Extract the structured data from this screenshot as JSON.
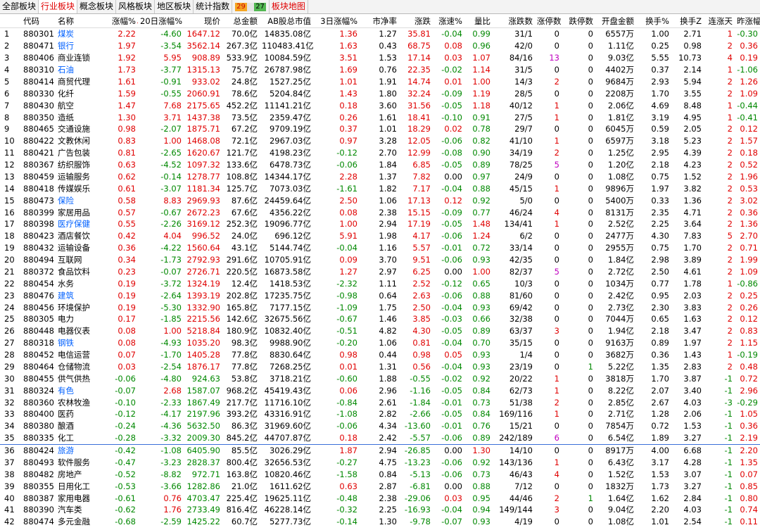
{
  "tabs": [
    {
      "label": "全部板块",
      "active": false
    },
    {
      "label": "行业板块",
      "active": true
    },
    {
      "label": "概念板块",
      "active": false
    },
    {
      "label": "风格板块",
      "active": false
    },
    {
      "label": "地区板块",
      "active": false
    },
    {
      "label": "统计指数",
      "active": false
    }
  ],
  "breadth": {
    "up": "29",
    "flat": "",
    "down": "27"
  },
  "map_tab": "板块地图",
  "columns": [
    "",
    "代码",
    "名称",
    "涨幅%",
    "20日涨幅%",
    "现价",
    "总金额",
    "AB股总市值",
    "3日涨幅%",
    "市净率",
    "涨跌",
    "涨速%",
    "量比",
    "涨跌数",
    "涨停数",
    "跌停数",
    "开盘金额",
    "换手%",
    "换手Z",
    "连涨天",
    "昨涨幅%"
  ],
  "sort_indicator": "↓",
  "rows": [
    [
      "1",
      "880301",
      "煤炭",
      "2.22",
      "-4.60",
      "1647.12",
      "70.0亿",
      "14835.08亿",
      "1.36",
      "1.27",
      "35.81",
      "-0.04",
      "0.99",
      "31/1",
      "0",
      "0",
      "6557万",
      "1.00",
      "2.71",
      "1",
      "-0.30"
    ],
    [
      "2",
      "880471",
      "银行",
      "1.97",
      "-3.54",
      "3562.14",
      "267.3亿",
      "110483.41亿",
      "1.63",
      "0.43",
      "68.75",
      "0.08",
      "0.96",
      "42/0",
      "0",
      "0",
      "1.11亿",
      "0.25",
      "0.98",
      "2",
      "0.36"
    ],
    [
      "3",
      "880406",
      "商业连锁",
      "1.92",
      "5.95",
      "908.89",
      "533.9亿",
      "10084.59亿",
      "3.51",
      "1.53",
      "17.14",
      "0.03",
      "1.07",
      "84/16",
      "13",
      "0",
      "9.03亿",
      "5.55",
      "10.73",
      "4",
      "0.19"
    ],
    [
      "4",
      "880310",
      "石油",
      "1.73",
      "-3.77",
      "1315.13",
      "75.7亿",
      "26787.98亿",
      "1.69",
      "0.76",
      "22.35",
      "-0.02",
      "1.14",
      "31/5",
      "0",
      "0",
      "4402万",
      "0.37",
      "2.14",
      "1",
      "-1.06"
    ],
    [
      "5",
      "880414",
      "商贸代理",
      "1.61",
      "-0.91",
      "933.02",
      "24.8亿",
      "1527.25亿",
      "1.01",
      "1.91",
      "14.74",
      "0.01",
      "1.00",
      "14/3",
      "2",
      "0",
      "9684万",
      "2.93",
      "5.94",
      "2",
      "1.26"
    ],
    [
      "6",
      "880330",
      "化纤",
      "1.59",
      "-0.55",
      "2060.91",
      "78.6亿",
      "5204.84亿",
      "1.43",
      "1.80",
      "32.24",
      "-0.09",
      "1.19",
      "28/5",
      "0",
      "0",
      "2208万",
      "1.70",
      "3.55",
      "2",
      "1.09"
    ],
    [
      "7",
      "880430",
      "航空",
      "1.47",
      "7.68",
      "2175.65",
      "452.2亿",
      "11141.21亿",
      "0.18",
      "3.60",
      "31.56",
      "-0.05",
      "1.18",
      "40/12",
      "1",
      "0",
      "2.06亿",
      "4.69",
      "8.48",
      "1",
      "-0.44"
    ],
    [
      "8",
      "880350",
      "造纸",
      "1.30",
      "3.71",
      "1437.38",
      "73.5亿",
      "2359.47亿",
      "0.26",
      "1.61",
      "18.41",
      "-0.10",
      "0.91",
      "27/5",
      "1",
      "0",
      "1.81亿",
      "3.19",
      "4.95",
      "1",
      "-0.41"
    ],
    [
      "9",
      "880465",
      "交通设施",
      "0.98",
      "-2.07",
      "1875.71",
      "67.2亿",
      "9709.19亿",
      "0.37",
      "1.01",
      "18.29",
      "0.02",
      "0.78",
      "29/7",
      "0",
      "0",
      "6045万",
      "0.59",
      "2.05",
      "2",
      "0.12"
    ],
    [
      "10",
      "880422",
      "文教休闲",
      "0.83",
      "1.00",
      "1468.08",
      "72.1亿",
      "2967.03亿",
      "0.97",
      "3.28",
      "12.05",
      "-0.06",
      "0.82",
      "41/10",
      "1",
      "0",
      "6597万",
      "3.18",
      "5.23",
      "2",
      "1.57"
    ],
    [
      "11",
      "880421",
      "广告包装",
      "0.81",
      "-2.65",
      "1620.67",
      "121.7亿",
      "4198.23亿",
      "-0.12",
      "2.70",
      "12.99",
      "-0.08",
      "0.90",
      "34/19",
      "2",
      "0",
      "1.25亿",
      "2.95",
      "4.39",
      "2",
      "0.18"
    ],
    [
      "12",
      "880367",
      "纺织服饰",
      "0.63",
      "-4.52",
      "1097.32",
      "133.6亿",
      "6478.73亿",
      "-0.06",
      "1.84",
      "6.85",
      "-0.05",
      "0.89",
      "78/25",
      "5",
      "0",
      "1.20亿",
      "2.18",
      "4.23",
      "2",
      "0.52"
    ],
    [
      "13",
      "880459",
      "运输服务",
      "0.62",
      "-0.14",
      "1278.77",
      "108.8亿",
      "14344.17亿",
      "2.28",
      "1.37",
      "7.82",
      "0.00",
      "0.97",
      "24/9",
      "0",
      "0",
      "1.08亿",
      "0.75",
      "1.52",
      "2",
      "1.96"
    ],
    [
      "14",
      "880418",
      "传媒娱乐",
      "0.61",
      "-3.07",
      "1181.34",
      "125.7亿",
      "7073.03亿",
      "-1.61",
      "1.82",
      "7.17",
      "-0.04",
      "0.88",
      "45/15",
      "1",
      "0",
      "9896万",
      "1.97",
      "3.82",
      "2",
      "0.53"
    ],
    [
      "15",
      "880473",
      "保险",
      "0.58",
      "8.83",
      "2969.93",
      "87.6亿",
      "24459.64亿",
      "2.50",
      "1.06",
      "17.13",
      "0.12",
      "0.92",
      "5/0",
      "0",
      "0",
      "5400万",
      "0.33",
      "1.36",
      "2",
      "3.02"
    ],
    [
      "16",
      "880399",
      "家居用品",
      "0.57",
      "-0.67",
      "2672.23",
      "67.6亿",
      "4356.22亿",
      "0.08",
      "2.38",
      "15.15",
      "-0.09",
      "0.77",
      "46/24",
      "4",
      "0",
      "8131万",
      "2.35",
      "4.71",
      "2",
      "0.36"
    ],
    [
      "17",
      "880398",
      "医疗保健",
      "0.55",
      "-2.26",
      "3169.12",
      "252.3亿",
      "19096.77亿",
      "1.00",
      "2.94",
      "17.19",
      "-0.05",
      "1.48",
      "134/41",
      "1",
      "0",
      "2.52亿",
      "2.25",
      "3.64",
      "2",
      "1.36"
    ],
    [
      "18",
      "880423",
      "酒店餐饮",
      "0.42",
      "4.04",
      "996.52",
      "24.0亿",
      "696.12亿",
      "5.91",
      "1.98",
      "4.17",
      "-0.06",
      "1.24",
      "6/2",
      "0",
      "0",
      "2477万",
      "4.30",
      "7.83",
      "5",
      "2.70"
    ],
    [
      "19",
      "880432",
      "运输设备",
      "0.36",
      "-4.22",
      "1560.64",
      "43.1亿",
      "5144.74亿",
      "-0.04",
      "1.16",
      "5.57",
      "-0.01",
      "0.72",
      "33/14",
      "0",
      "0",
      "2955万",
      "0.75",
      "1.70",
      "2",
      "0.71"
    ],
    [
      "20",
      "880494",
      "互联网",
      "0.34",
      "-1.73",
      "2792.93",
      "291.6亿",
      "10705.91亿",
      "0.09",
      "3.70",
      "9.51",
      "-0.06",
      "0.93",
      "42/35",
      "0",
      "0",
      "1.84亿",
      "2.98",
      "3.89",
      "2",
      "1.99"
    ],
    [
      "21",
      "880372",
      "食品饮料",
      "0.23",
      "-0.07",
      "2726.71",
      "220.5亿",
      "16873.58亿",
      "1.27",
      "2.97",
      "6.25",
      "0.00",
      "1.00",
      "82/37",
      "5",
      "0",
      "2.72亿",
      "2.50",
      "4.61",
      "2",
      "1.09"
    ],
    [
      "22",
      "880454",
      "水务",
      "0.19",
      "-3.72",
      "1324.19",
      "12.4亿",
      "1418.53亿",
      "-2.32",
      "1.11",
      "2.52",
      "-0.12",
      "0.65",
      "10/3",
      "0",
      "0",
      "1034万",
      "0.77",
      "1.78",
      "1",
      "-0.86"
    ],
    [
      "23",
      "880476",
      "建筑",
      "0.19",
      "-2.64",
      "1393.19",
      "202.8亿",
      "17235.75亿",
      "-0.98",
      "0.64",
      "2.63",
      "-0.06",
      "0.88",
      "81/60",
      "0",
      "0",
      "2.42亿",
      "0.95",
      "2.03",
      "2",
      "0.25"
    ],
    [
      "24",
      "880456",
      "环境保护",
      "0.19",
      "-5.30",
      "1332.90",
      "165.8亿",
      "7177.15亿",
      "-1.09",
      "1.75",
      "2.50",
      "-0.04",
      "0.93",
      "69/42",
      "0",
      "0",
      "2.73亿",
      "2.30",
      "3.83",
      "2",
      "0.26"
    ],
    [
      "25",
      "880305",
      "电力",
      "0.17",
      "-1.85",
      "2215.56",
      "142.6亿",
      "32675.56亿",
      "-0.67",
      "1.46",
      "3.85",
      "-0.03",
      "0.66",
      "32/38",
      "0",
      "0",
      "7044万",
      "0.65",
      "1.63",
      "2",
      "0.12"
    ],
    [
      "26",
      "880448",
      "电器仪表",
      "0.08",
      "1.00",
      "5218.84",
      "180.9亿",
      "10832.40亿",
      "-0.51",
      "4.82",
      "4.30",
      "-0.05",
      "0.89",
      "63/37",
      "3",
      "0",
      "1.94亿",
      "2.18",
      "3.47",
      "2",
      "0.83"
    ],
    [
      "27",
      "880318",
      "钢铁",
      "0.08",
      "-4.93",
      "1035.20",
      "98.3亿",
      "9988.90亿",
      "-0.20",
      "1.06",
      "0.81",
      "-0.04",
      "0.70",
      "35/15",
      "0",
      "0",
      "9163万",
      "0.89",
      "1.97",
      "2",
      "1.15"
    ],
    [
      "28",
      "880452",
      "电信运营",
      "0.07",
      "-1.70",
      "1405.28",
      "77.8亿",
      "8830.64亿",
      "0.98",
      "0.44",
      "0.98",
      "0.05",
      "0.93",
      "1/4",
      "0",
      "0",
      "3682万",
      "0.36",
      "1.43",
      "1",
      "-0.19"
    ],
    [
      "29",
      "880464",
      "仓储物流",
      "0.03",
      "-2.54",
      "1876.17",
      "77.8亿",
      "7268.25亿",
      "0.01",
      "1.31",
      "0.56",
      "-0.04",
      "0.93",
      "23/19",
      "0",
      "1",
      "5.22亿",
      "1.35",
      "2.83",
      "2",
      "0.48"
    ],
    [
      "30",
      "880455",
      "供气供热",
      "-0.06",
      "-4.80",
      "924.63",
      "53.8亿",
      "3718.21亿",
      "-0.60",
      "1.88",
      "-0.55",
      "-0.02",
      "0.92",
      "20/22",
      "1",
      "0",
      "3818万",
      "1.70",
      "3.87",
      "-1",
      "0.72"
    ],
    [
      "31",
      "880324",
      "有色",
      "-0.07",
      "2.68",
      "1587.07",
      "968.2亿",
      "45419.43亿",
      "0.06",
      "2.96",
      "-1.16",
      "-0.05",
      "0.84",
      "62/73",
      "1",
      "0",
      "8.22亿",
      "2.07",
      "3.40",
      "-1",
      "2.96"
    ],
    [
      "32",
      "880360",
      "农林牧渔",
      "-0.10",
      "-2.33",
      "1867.49",
      "217.7亿",
      "11716.10亿",
      "-0.84",
      "2.61",
      "-1.84",
      "-0.01",
      "0.73",
      "51/38",
      "2",
      "0",
      "2.85亿",
      "2.67",
      "4.03",
      "-3",
      "-0.29"
    ],
    [
      "33",
      "880400",
      "医药",
      "-0.12",
      "-4.17",
      "2197.96",
      "393.2亿",
      "43316.91亿",
      "-1.08",
      "2.82",
      "-2.66",
      "-0.05",
      "0.84",
      "169/116",
      "1",
      "0",
      "2.71亿",
      "1.28",
      "2.06",
      "-1",
      "1.05"
    ],
    [
      "34",
      "880380",
      "酿酒",
      "-0.24",
      "-4.36",
      "5632.50",
      "86.3亿",
      "31969.60亿",
      "-0.06",
      "4.34",
      "-13.60",
      "-0.01",
      "0.76",
      "15/21",
      "0",
      "0",
      "7854万",
      "0.72",
      "1.53",
      "-1",
      "0.36"
    ],
    [
      "35",
      "880335",
      "化工",
      "-0.28",
      "-3.32",
      "2009.30",
      "845.2亿",
      "44707.87亿",
      "0.18",
      "2.42",
      "-5.57",
      "-0.06",
      "0.89",
      "242/189",
      "6",
      "0",
      "6.54亿",
      "1.89",
      "3.27",
      "-1",
      "2.19"
    ],
    [
      "36",
      "880424",
      "旅游",
      "-0.42",
      "-1.08",
      "6405.90",
      "85.5亿",
      "3026.29亿",
      "1.87",
      "2.94",
      "-26.85",
      "0.00",
      "1.30",
      "14/10",
      "0",
      "0",
      "8917万",
      "4.00",
      "6.68",
      "-1",
      "2.20"
    ],
    [
      "37",
      "880493",
      "软件服务",
      "-0.47",
      "-3.23",
      "2828.37",
      "800.4亿",
      "32656.53亿",
      "-0.27",
      "4.75",
      "-13.23",
      "-0.06",
      "0.92",
      "143/136",
      "1",
      "0",
      "6.43亿",
      "3.17",
      "4.28",
      "-1",
      "1.35"
    ],
    [
      "38",
      "880482",
      "房地产",
      "-0.52",
      "-8.82",
      "972.71",
      "163.8亿",
      "10820.46亿",
      "-1.58",
      "0.84",
      "-5.13",
      "-0.06",
      "0.73",
      "46/43",
      "4",
      "0",
      "1.52亿",
      "1.53",
      "3.07",
      "-1",
      "0.07"
    ],
    [
      "39",
      "880355",
      "日用化工",
      "-0.53",
      "-3.66",
      "1282.86",
      "21.0亿",
      "1611.62亿",
      "0.63",
      "2.87",
      "-6.81",
      "0.00",
      "0.88",
      "7/12",
      "0",
      "0",
      "1832万",
      "1.73",
      "3.27",
      "-1",
      "0.85"
    ],
    [
      "40",
      "880387",
      "家用电器",
      "-0.61",
      "0.76",
      "4703.47",
      "225.4亿",
      "19625.11亿",
      "-0.48",
      "2.38",
      "-29.06",
      "0.03",
      "0.95",
      "44/46",
      "2",
      "1",
      "1.64亿",
      "1.62",
      "2.84",
      "-1",
      "0.80"
    ],
    [
      "41",
      "880390",
      "汽车类",
      "-0.62",
      "1.76",
      "2733.49",
      "816.4亿",
      "46228.14亿",
      "-0.32",
      "2.25",
      "-16.93",
      "-0.04",
      "0.94",
      "149/144",
      "3",
      "0",
      "9.04亿",
      "2.20",
      "4.03",
      "-1",
      "0.74"
    ],
    [
      "42",
      "880474",
      "多元金融",
      "-0.68",
      "-2.59",
      "1425.22",
      "60.7亿",
      "5277.73亿",
      "-0.14",
      "1.30",
      "-9.78",
      "-0.07",
      "0.93",
      "4/19",
      "0",
      "0",
      "1.08亿",
      "1.01",
      "2.54",
      "-1",
      "0.11"
    ]
  ],
  "highlight_names": [
    "煤炭",
    "银行",
    "石油",
    "保险",
    "医疗保健",
    "建筑",
    "钢铁",
    "有色",
    "旅游"
  ],
  "colors": {
    "up": "#e00000",
    "down": "#008800",
    "blue": "#0060ff",
    "magenta": "#c000c0"
  }
}
